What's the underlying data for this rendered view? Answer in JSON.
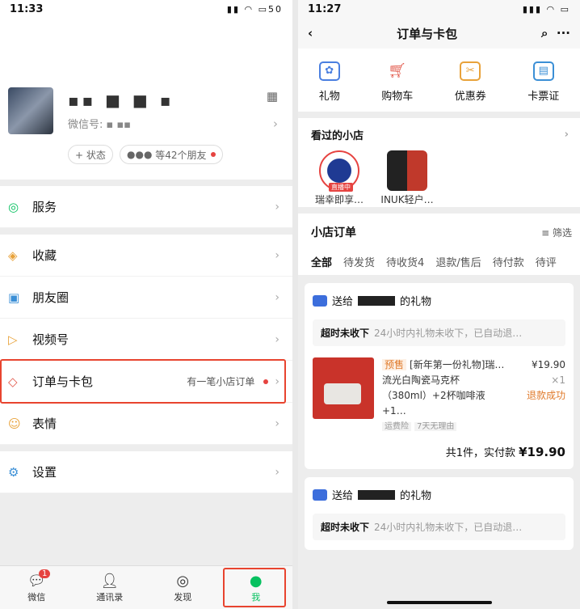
{
  "left": {
    "status": {
      "time": "11:33",
      "battery": "50"
    },
    "profile": {
      "id_label": "微信号:",
      "status_btn": "+ 状态",
      "friends": "等42个朋友"
    },
    "menu": [
      {
        "label": "服务",
        "icon": "service-icon"
      },
      {
        "label": "收藏",
        "icon": "favorites-icon"
      },
      {
        "label": "朋友圈",
        "icon": "moments-icon"
      },
      {
        "label": "视频号",
        "icon": "channels-icon"
      },
      {
        "label": "订单与卡包",
        "icon": "orders-icon",
        "note": "有一笔小店订单"
      },
      {
        "label": "表情",
        "icon": "sticker-icon"
      },
      {
        "label": "设置",
        "icon": "settings-icon"
      }
    ],
    "tabs": [
      {
        "label": "微信",
        "badge": "1"
      },
      {
        "label": "通讯录"
      },
      {
        "label": "发现"
      },
      {
        "label": "我",
        "active": true
      }
    ]
  },
  "right": {
    "status": {
      "time": "11:27"
    },
    "nav": {
      "title": "订单与卡包"
    },
    "quick": [
      {
        "label": "礼物",
        "color": "#4a7fe0"
      },
      {
        "label": "购物车",
        "color": "#e2584a"
      },
      {
        "label": "优惠券",
        "color": "#e8a23a"
      },
      {
        "label": "卡票证",
        "color": "#3b8fd6"
      }
    ],
    "shops_title": "看过的小店",
    "shops": [
      {
        "name": "瑞幸即享…",
        "live": "直播中"
      },
      {
        "name": "INUK轻户…"
      }
    ],
    "orders_title": "小店订单",
    "filter_label": "筛选",
    "filters": [
      "全部",
      "待发货",
      "待收货4",
      "退款/售后",
      "待付款",
      "待评"
    ],
    "orders": [
      {
        "title_pre": "送给",
        "title_post": "的礼物",
        "note_bold": "超时未收下",
        "note_text": "24小时内礼物未收下，已自动退…",
        "pre_tag": "预售",
        "product": "[新年第一份礼物]瑞…",
        "product_line2": "流光白陶瓷马克杯",
        "product_line3": "（380ml）+2杯咖啡液+1…",
        "tags": [
          "运费险",
          "7天无理由"
        ],
        "price": "¥19.90",
        "qty": "×1",
        "state": "退款成功",
        "total_label": "共1件，实付款",
        "total": "¥19.90"
      },
      {
        "title_pre": "送给",
        "title_post": "的礼物",
        "note_bold": "超时未收下",
        "note_text": "24小时内礼物未收下，已自动退…"
      }
    ]
  }
}
